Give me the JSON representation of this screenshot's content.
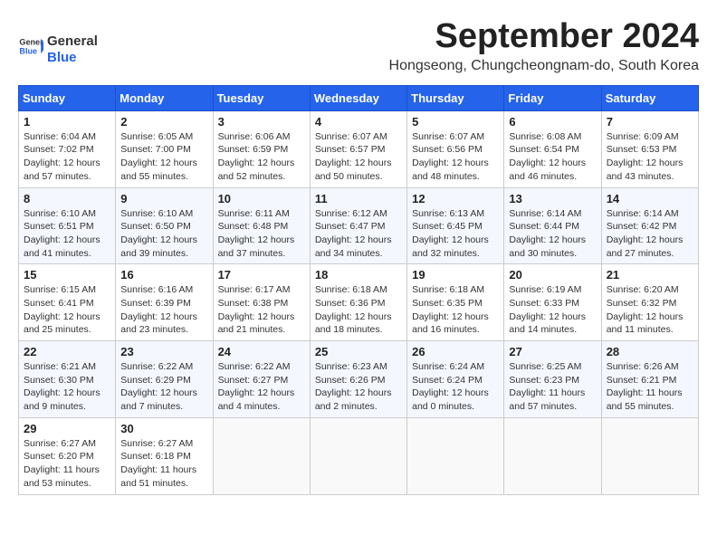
{
  "header": {
    "logo_line1": "General",
    "logo_line2": "Blue",
    "month_title": "September 2024",
    "location": "Hongseong, Chungcheongnam-do, South Korea"
  },
  "weekdays": [
    "Sunday",
    "Monday",
    "Tuesday",
    "Wednesday",
    "Thursday",
    "Friday",
    "Saturday"
  ],
  "weeks": [
    [
      {
        "day": "1",
        "info": "Sunrise: 6:04 AM\nSunset: 7:02 PM\nDaylight: 12 hours\nand 57 minutes."
      },
      {
        "day": "2",
        "info": "Sunrise: 6:05 AM\nSunset: 7:00 PM\nDaylight: 12 hours\nand 55 minutes."
      },
      {
        "day": "3",
        "info": "Sunrise: 6:06 AM\nSunset: 6:59 PM\nDaylight: 12 hours\nand 52 minutes."
      },
      {
        "day": "4",
        "info": "Sunrise: 6:07 AM\nSunset: 6:57 PM\nDaylight: 12 hours\nand 50 minutes."
      },
      {
        "day": "5",
        "info": "Sunrise: 6:07 AM\nSunset: 6:56 PM\nDaylight: 12 hours\nand 48 minutes."
      },
      {
        "day": "6",
        "info": "Sunrise: 6:08 AM\nSunset: 6:54 PM\nDaylight: 12 hours\nand 46 minutes."
      },
      {
        "day": "7",
        "info": "Sunrise: 6:09 AM\nSunset: 6:53 PM\nDaylight: 12 hours\nand 43 minutes."
      }
    ],
    [
      {
        "day": "8",
        "info": "Sunrise: 6:10 AM\nSunset: 6:51 PM\nDaylight: 12 hours\nand 41 minutes."
      },
      {
        "day": "9",
        "info": "Sunrise: 6:10 AM\nSunset: 6:50 PM\nDaylight: 12 hours\nand 39 minutes."
      },
      {
        "day": "10",
        "info": "Sunrise: 6:11 AM\nSunset: 6:48 PM\nDaylight: 12 hours\nand 37 minutes."
      },
      {
        "day": "11",
        "info": "Sunrise: 6:12 AM\nSunset: 6:47 PM\nDaylight: 12 hours\nand 34 minutes."
      },
      {
        "day": "12",
        "info": "Sunrise: 6:13 AM\nSunset: 6:45 PM\nDaylight: 12 hours\nand 32 minutes."
      },
      {
        "day": "13",
        "info": "Sunrise: 6:14 AM\nSunset: 6:44 PM\nDaylight: 12 hours\nand 30 minutes."
      },
      {
        "day": "14",
        "info": "Sunrise: 6:14 AM\nSunset: 6:42 PM\nDaylight: 12 hours\nand 27 minutes."
      }
    ],
    [
      {
        "day": "15",
        "info": "Sunrise: 6:15 AM\nSunset: 6:41 PM\nDaylight: 12 hours\nand 25 minutes."
      },
      {
        "day": "16",
        "info": "Sunrise: 6:16 AM\nSunset: 6:39 PM\nDaylight: 12 hours\nand 23 minutes."
      },
      {
        "day": "17",
        "info": "Sunrise: 6:17 AM\nSunset: 6:38 PM\nDaylight: 12 hours\nand 21 minutes."
      },
      {
        "day": "18",
        "info": "Sunrise: 6:18 AM\nSunset: 6:36 PM\nDaylight: 12 hours\nand 18 minutes."
      },
      {
        "day": "19",
        "info": "Sunrise: 6:18 AM\nSunset: 6:35 PM\nDaylight: 12 hours\nand 16 minutes."
      },
      {
        "day": "20",
        "info": "Sunrise: 6:19 AM\nSunset: 6:33 PM\nDaylight: 12 hours\nand 14 minutes."
      },
      {
        "day": "21",
        "info": "Sunrise: 6:20 AM\nSunset: 6:32 PM\nDaylight: 12 hours\nand 11 minutes."
      }
    ],
    [
      {
        "day": "22",
        "info": "Sunrise: 6:21 AM\nSunset: 6:30 PM\nDaylight: 12 hours\nand 9 minutes."
      },
      {
        "day": "23",
        "info": "Sunrise: 6:22 AM\nSunset: 6:29 PM\nDaylight: 12 hours\nand 7 minutes."
      },
      {
        "day": "24",
        "info": "Sunrise: 6:22 AM\nSunset: 6:27 PM\nDaylight: 12 hours\nand 4 minutes."
      },
      {
        "day": "25",
        "info": "Sunrise: 6:23 AM\nSunset: 6:26 PM\nDaylight: 12 hours\nand 2 minutes."
      },
      {
        "day": "26",
        "info": "Sunrise: 6:24 AM\nSunset: 6:24 PM\nDaylight: 12 hours\nand 0 minutes."
      },
      {
        "day": "27",
        "info": "Sunrise: 6:25 AM\nSunset: 6:23 PM\nDaylight: 11 hours\nand 57 minutes."
      },
      {
        "day": "28",
        "info": "Sunrise: 6:26 AM\nSunset: 6:21 PM\nDaylight: 11 hours\nand 55 minutes."
      }
    ],
    [
      {
        "day": "29",
        "info": "Sunrise: 6:27 AM\nSunset: 6:20 PM\nDaylight: 11 hours\nand 53 minutes."
      },
      {
        "day": "30",
        "info": "Sunrise: 6:27 AM\nSunset: 6:18 PM\nDaylight: 11 hours\nand 51 minutes."
      },
      {
        "day": "",
        "info": ""
      },
      {
        "day": "",
        "info": ""
      },
      {
        "day": "",
        "info": ""
      },
      {
        "day": "",
        "info": ""
      },
      {
        "day": "",
        "info": ""
      }
    ]
  ]
}
